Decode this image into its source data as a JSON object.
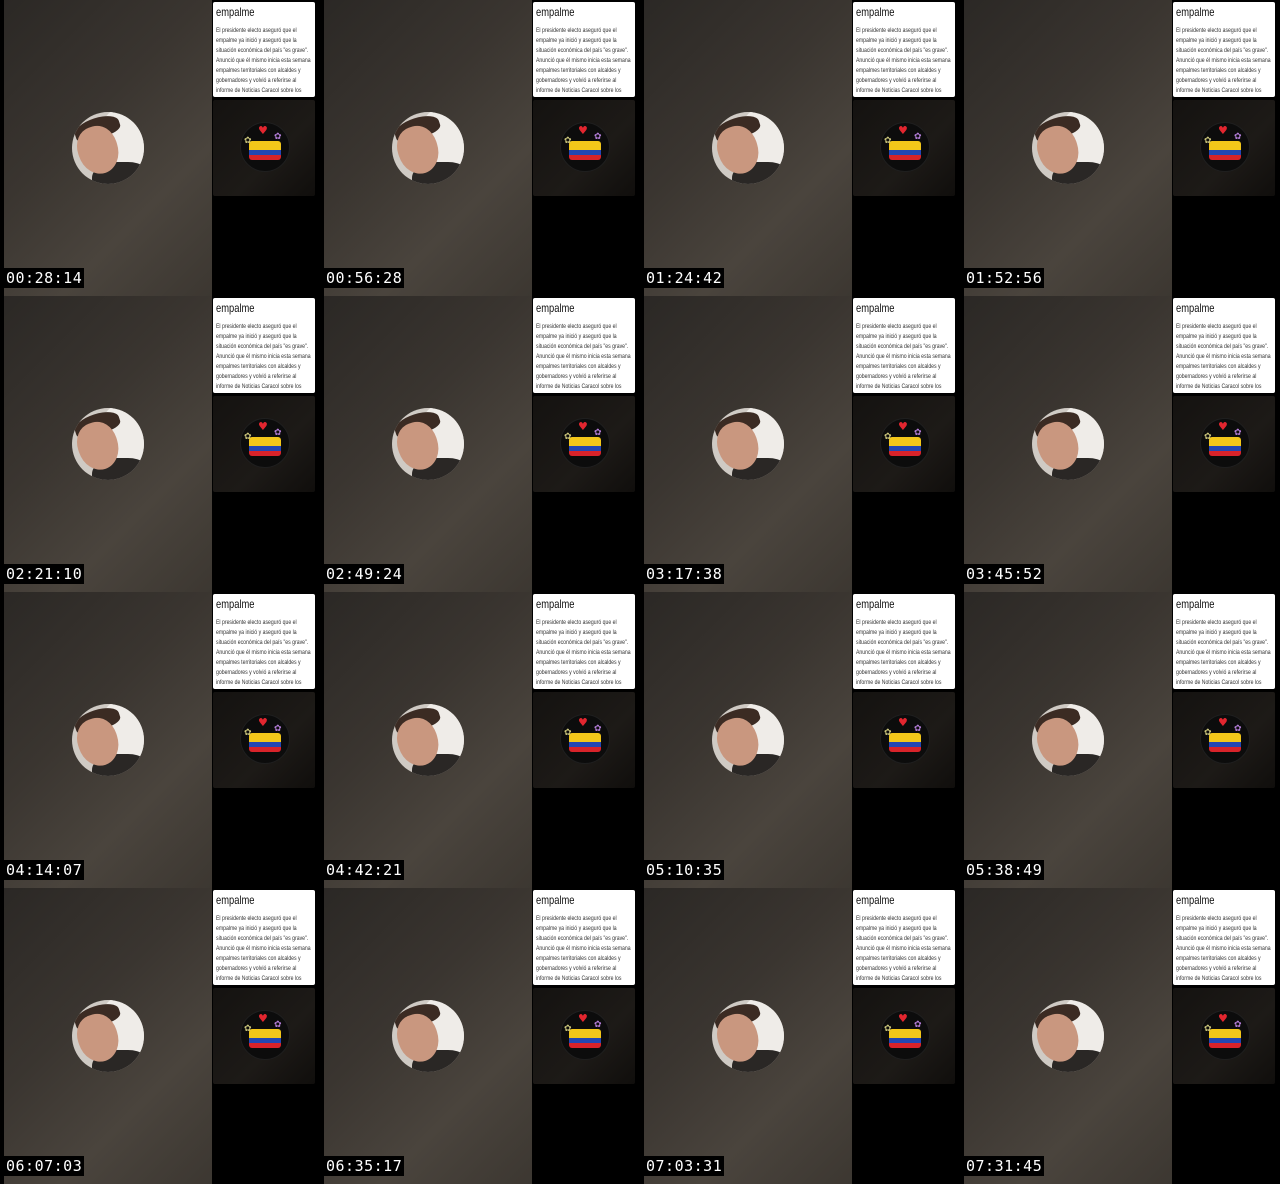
{
  "frame": {
    "note_title": "empalme",
    "note_text": "El presidente electo aseguró que el empalme ya inició y aseguró que la situación económica del país \"es grave\". Anunció que él mismo inicia esta semana empalmes territoriales con alcaldes y gobernadores y volvió a referirse al informe de Noticias Caracol sobre los presuntos acuerdos del",
    "sticker_icon": "heart-colombia-flag-sticker-icon",
    "colors": {
      "flag_yellow": "#f3c71a",
      "flag_blue": "#2347b3",
      "flag_red": "#d8232a",
      "heart": "#e3262f"
    }
  },
  "timestamps": [
    "00:28:14",
    "00:56:28",
    "01:24:42",
    "01:52:56",
    "02:21:10",
    "02:49:24",
    "03:17:38",
    "03:45:52",
    "04:14:07",
    "04:42:21",
    "05:10:35",
    "05:38:49",
    "06:07:03",
    "06:35:17",
    "07:03:31",
    "07:31:45"
  ]
}
